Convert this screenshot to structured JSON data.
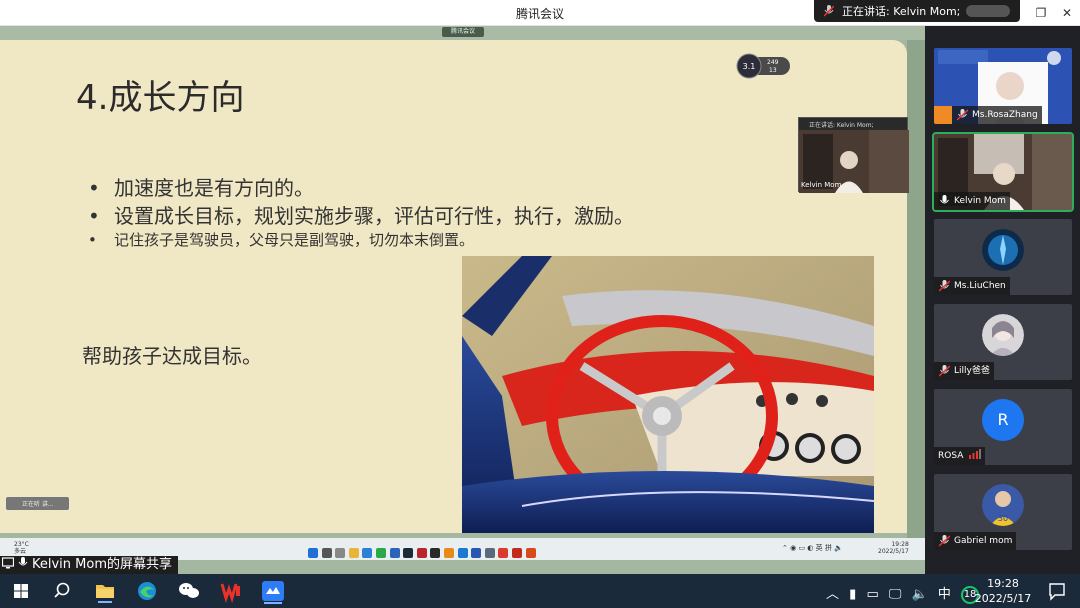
{
  "window": {
    "title": "腾讯会议"
  },
  "speaking": {
    "text": "正在讲话: Kelvin Mom;"
  },
  "share": {
    "top_tag": "腾讯会议",
    "label": "Kelvin Mom的屏幕共享"
  },
  "slide": {
    "title": "4.成长方向",
    "bullets": [
      "加速度也是有方向的。",
      "设置成长目标，规划实施步骤，评估可行性，执行，激励。",
      "记住孩子是驾驶员，父母只是副驾驶，切勿本末倒置。"
    ],
    "help_text": "帮助孩子达成目标。",
    "badge": {
      "a": "249",
      "b": "13"
    }
  },
  "mini_video": {
    "header": "正在讲话: Kelvin Mom;",
    "label": "Kelvin Mom"
  },
  "inner_taskbar": {
    "weather_temp": "23°C",
    "weather_desc": "多云",
    "tray_ime1": "英",
    "tray_ime2": "拼",
    "time": "19:28",
    "date": "2022/5/17",
    "chip_text": "正在听 讲..."
  },
  "participants": [
    {
      "name": "Ms.RosaZhang",
      "mic": "muted"
    },
    {
      "name": "Kelvin Mom",
      "mic": "on"
    },
    {
      "name": "Ms.LiuChen",
      "mic": "muted"
    },
    {
      "name": "Lilly爸爸",
      "mic": "muted"
    },
    {
      "name": "ROSA",
      "mic": "none",
      "initial": "R"
    },
    {
      "name": "Gabriel mom",
      "mic": "muted"
    }
  ],
  "taskbar": {
    "ime": "中",
    "notification_count": "18",
    "time": "19:28",
    "date": "2022/5/17"
  },
  "colors": {
    "slide_bg": "#f0e7c5",
    "active_speaker": "#2fae5a",
    "avatar_blue": "#1e77f0",
    "taskbar_bg": "#1b2a3a"
  }
}
